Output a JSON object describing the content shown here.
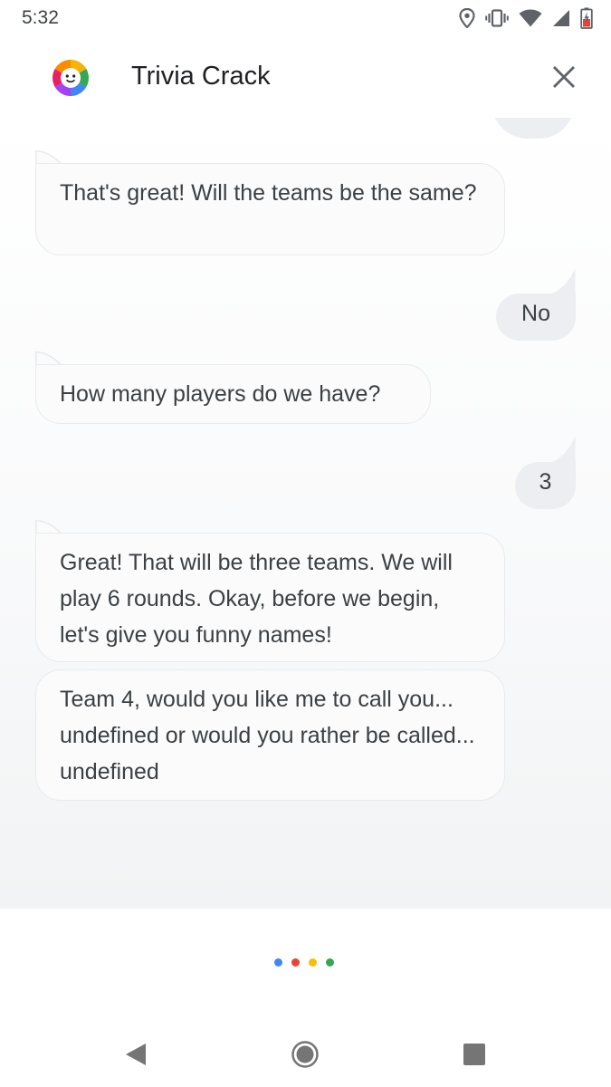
{
  "status_bar": {
    "time": "5:32",
    "icons": [
      "location-icon",
      "vibrate-icon",
      "wifi-icon",
      "signal-icon",
      "battery-icon"
    ]
  },
  "header": {
    "title": "Trivia Crack",
    "logo_icon": "trivia-crack-logo",
    "close_icon": "close-icon"
  },
  "conversation": {
    "messages": [
      {
        "from": "bot",
        "text": "That's great! Will the teams be the same?"
      },
      {
        "from": "user",
        "text": "No"
      },
      {
        "from": "bot",
        "text": "How many players do we have?"
      },
      {
        "from": "user",
        "text": "3"
      },
      {
        "from": "bot",
        "text": "Great! That will be three teams. We will play 6 rounds. Okay, before we begin, let's give you funny names!"
      },
      {
        "from": "bot",
        "text": "Team 4, would you like me to call you... undefined or would you rather be called... undefined"
      }
    ]
  },
  "assistant": {
    "dot_colors": [
      "#4285f4",
      "#ea4335",
      "#fbbc05",
      "#34a853"
    ]
  },
  "nav": {
    "back_icon": "back-icon",
    "home_icon": "home-icon",
    "recents_icon": "recents-icon"
  },
  "colors": {
    "bot_bubble": "#fbfbfc",
    "user_bubble": "#eceef1",
    "text": "#3c4043"
  }
}
